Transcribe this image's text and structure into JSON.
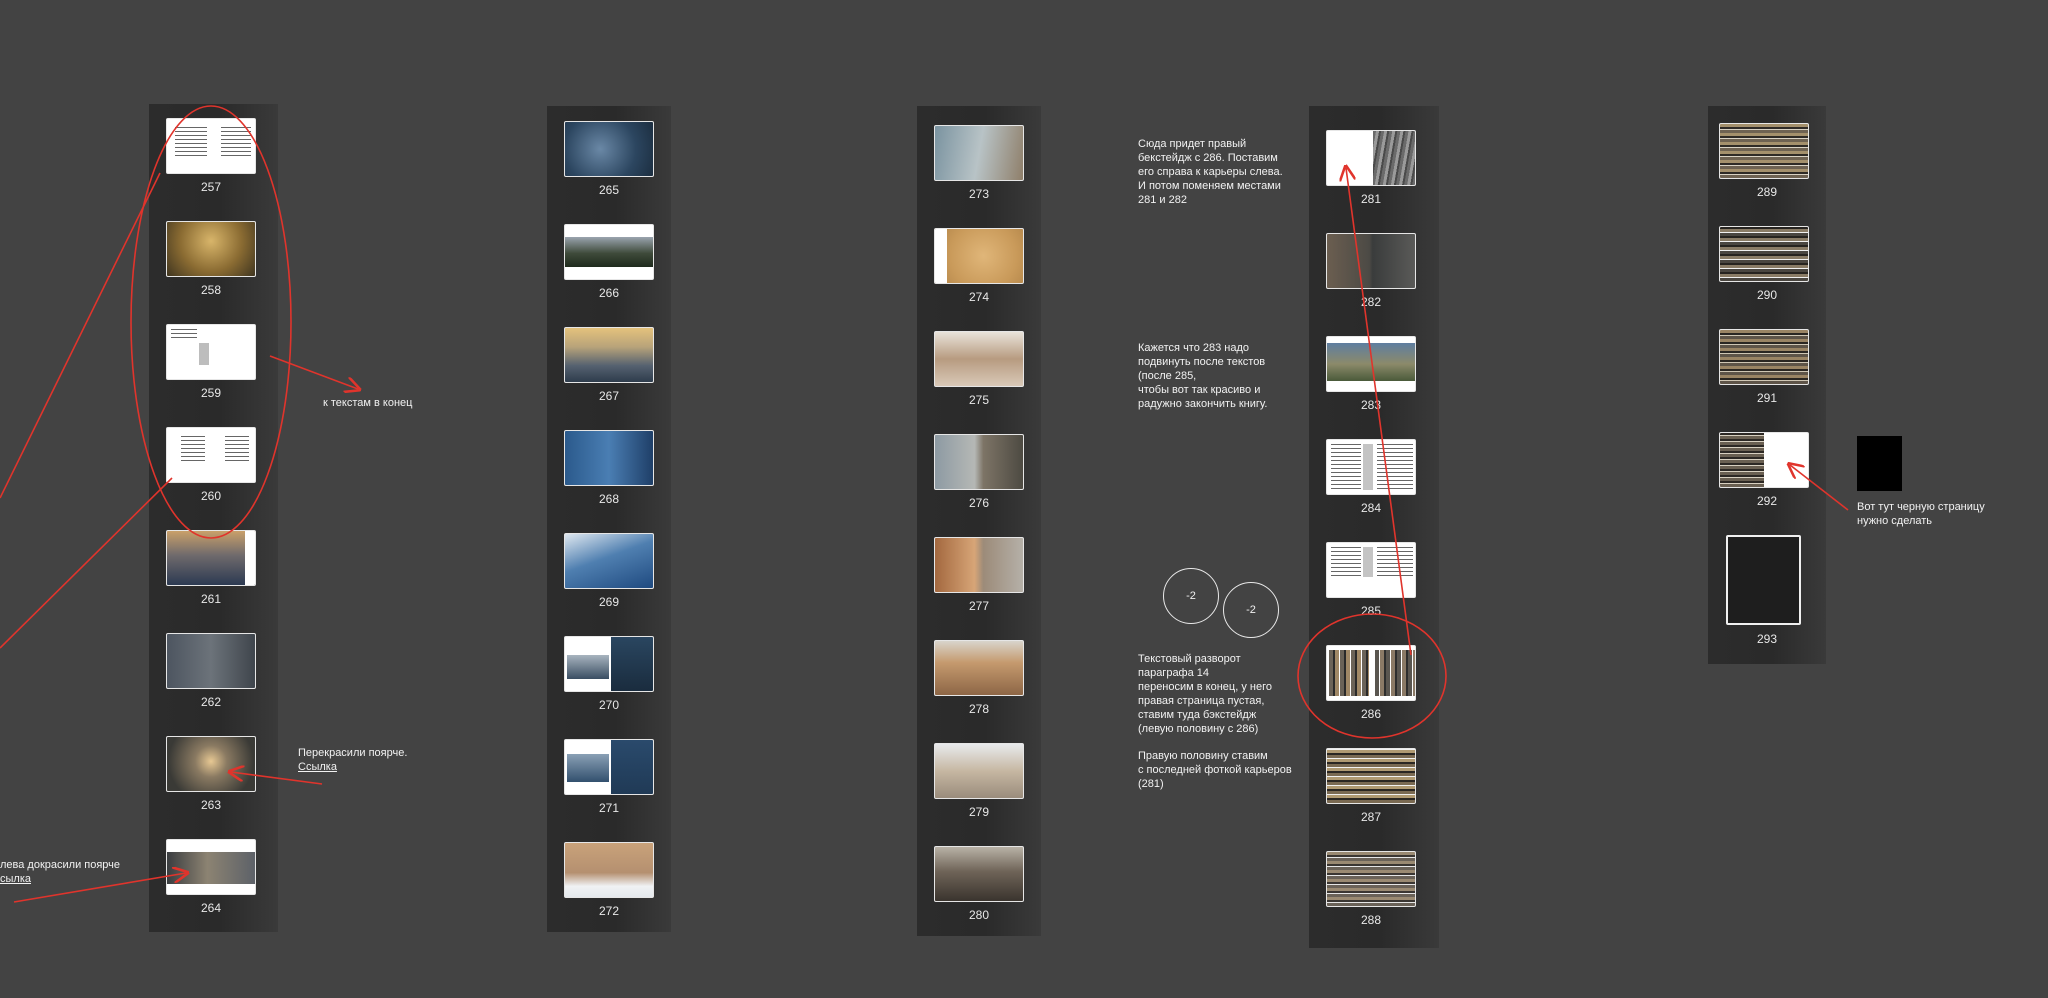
{
  "pages": {
    "p257": "257",
    "p258": "258",
    "p259": "259",
    "p260": "260",
    "p261": "261",
    "p262": "262",
    "p263": "263",
    "p264": "264",
    "p265": "265",
    "p266": "266",
    "p267": "267",
    "p268": "268",
    "p269": "269",
    "p270": "270",
    "p271": "271",
    "p272": "272",
    "p273": "273",
    "p274": "274",
    "p275": "275",
    "p276": "276",
    "p277": "277",
    "p278": "278",
    "p279": "279",
    "p280": "280",
    "p281": "281",
    "p282": "282",
    "p283": "283",
    "p284": "284",
    "p285": "285",
    "p286": "286",
    "p287": "287",
    "p288": "288",
    "p289": "289",
    "p290": "290",
    "p291": "291",
    "p292": "292",
    "p293": "293"
  },
  "notes": {
    "to_end": "к текстам в конец",
    "recolored": "Перекрасили поярче.",
    "recolored_link": "Ссылка",
    "left_recolored": "лева докрасили поярче",
    "left_link": "сылка",
    "backstage_note": "Сюда придет правый\nбекстейдж с 286. Поставим\nего справа к карьеры слева.\nИ потом поменяем местами\n281 и 282",
    "move_283_note": "Кажется что 283 надо\nподвинуть после текстов\n(после 285,\nчтобы вот так красиво и\nрадужно закончить книгу.",
    "circle_a": "-2",
    "circle_b": "-2",
    "text_spread_note": "Текстовый разворот\nпараграфа 14\nпереносим в конец, у него\nправая страница пустая,\nставим туда бэкстейдж\n(левую половину с 286)",
    "right_half_note": "Правую половину ставим\nс последней фоткой карьеров\n(281)",
    "black_page_note": "Вот тут черную страницу\nнужно сделать"
  },
  "colors": {
    "background": "#434343",
    "column": "#2b2b2b",
    "annotation_red": "#e0342c"
  }
}
